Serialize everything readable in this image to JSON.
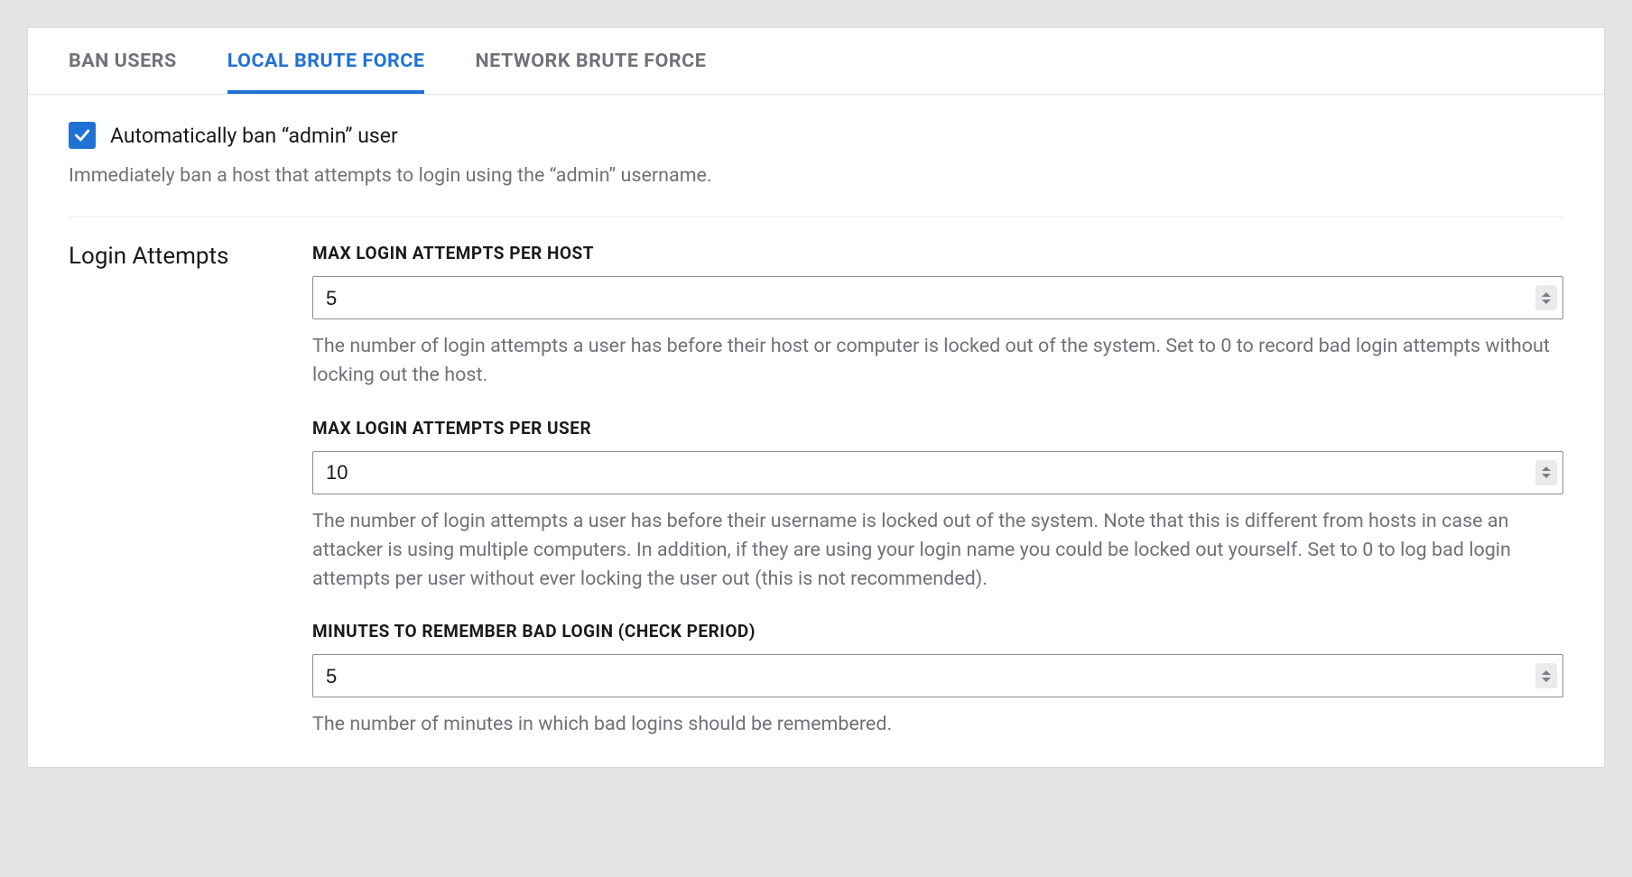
{
  "tabs": [
    {
      "label": "BAN USERS",
      "active": false
    },
    {
      "label": "LOCAL BRUTE FORCE",
      "active": true
    },
    {
      "label": "NETWORK BRUTE FORCE",
      "active": false
    }
  ],
  "auto_ban": {
    "checked": true,
    "label": "Automatically ban “admin” user",
    "description": "Immediately ban a host that attempts to login using the “admin” username."
  },
  "login_attempts": {
    "section_title": "Login Attempts",
    "fields": {
      "max_per_host": {
        "label": "MAX LOGIN ATTEMPTS PER HOST",
        "value": "5",
        "description": "The number of login attempts a user has before their host or computer is locked out of the system. Set to 0 to record bad login attempts without locking out the host."
      },
      "max_per_user": {
        "label": "MAX LOGIN ATTEMPTS PER USER",
        "value": "10",
        "description": "The number of login attempts a user has before their username is locked out of the system. Note that this is different from hosts in case an attacker is using multiple computers. In addition, if they are using your login name you could be locked out yourself. Set to 0 to log bad login attempts per user without ever locking the user out (this is not recommended)."
      },
      "remember_minutes": {
        "label": "MINUTES TO REMEMBER BAD LOGIN (CHECK PERIOD)",
        "value": "5",
        "description": "The number of minutes in which bad logins should be remembered."
      }
    }
  }
}
